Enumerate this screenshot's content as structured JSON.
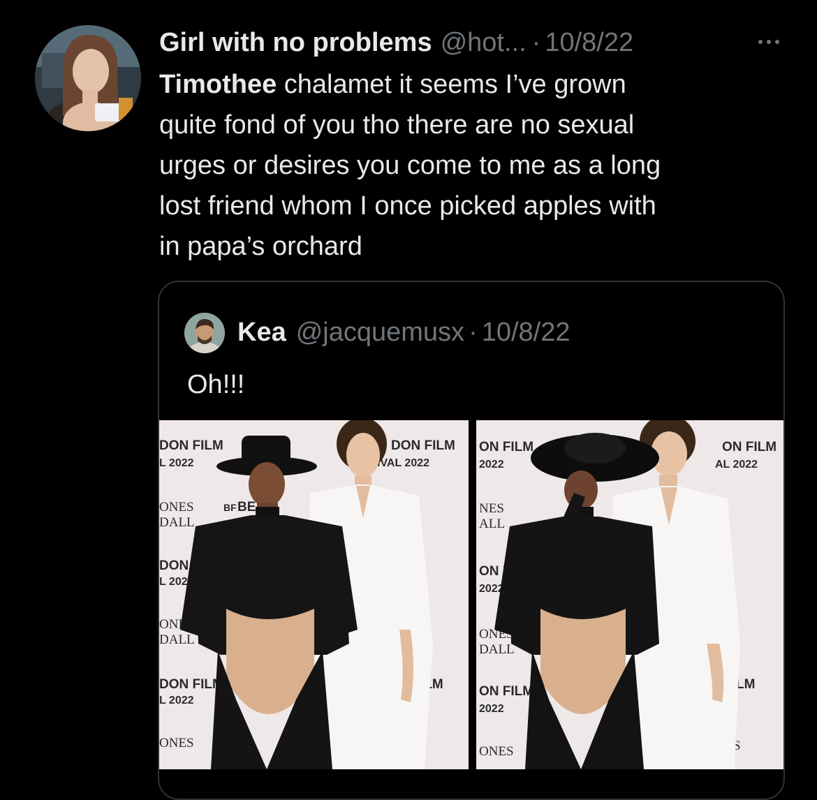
{
  "tweet": {
    "display_name": "Girl with no problems",
    "handle": "@hot...",
    "separator": "·",
    "date": "10/8/22",
    "text_bold": "Timothee",
    "text_rest": " chalamet it seems I’ve grown\nquite fond of you tho there are no sexual\nurges or desires you come to me as a long\nlost friend whom I once picked apples with\nin papa’s orchard",
    "more_icon": "more-horizontal-icon"
  },
  "quoted_tweet": {
    "display_name": "Kea",
    "handle": "@jacquemusx",
    "separator": "·",
    "date": "10/8/22",
    "text": "Oh!!!",
    "photos": [
      {
        "backdrop_text": [
          "DON FILM",
          "L 2022",
          "ONES",
          "DALL",
          "DON FILM",
          "L 2022",
          "ONES",
          "DALL",
          "DON FILM",
          "L 2022",
          "ONES",
          "DON FILM",
          "IVAL 2022",
          "ILM",
          "S",
          "BF",
          "BE"
        ]
      },
      {
        "backdrop_text": [
          "ON FILM",
          "2022",
          "NES",
          "ALL",
          "ON FIL",
          "2022",
          "ONES",
          "DALL",
          "ON FILM",
          "2022",
          "ONES",
          "ON FILM",
          "AL 2022",
          "LM",
          "S"
        ]
      }
    ]
  },
  "colors": {
    "background": "#000000",
    "primary_text": "#e7e9ea",
    "secondary_text": "#71767b",
    "border": "#2f3336"
  }
}
